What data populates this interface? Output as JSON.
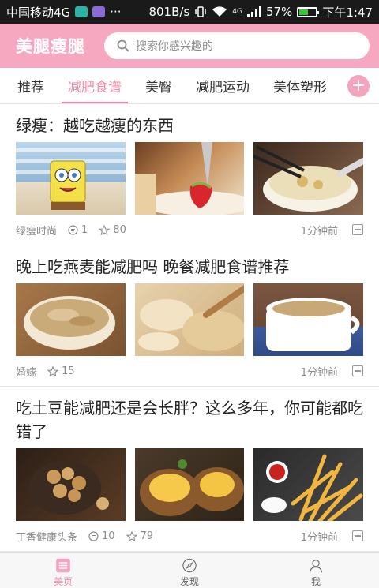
{
  "status_bar": {
    "carrier": "中国移动4G",
    "more": "···",
    "speed": "801B/s",
    "network": "4G",
    "battery": "57%",
    "battery_level": 0.57,
    "time": "下午1:47"
  },
  "header": {
    "title": "美腿瘦腿",
    "search_placeholder": "搜索你感兴趣的"
  },
  "tabs": [
    {
      "label": "推荐",
      "active": false
    },
    {
      "label": "减肥食谱",
      "active": true
    },
    {
      "label": "美臀",
      "active": false
    },
    {
      "label": "减肥运动",
      "active": false
    },
    {
      "label": "美体塑形",
      "active": false
    }
  ],
  "articles": [
    {
      "title": "绿瘦：越吃越瘦的东西",
      "source": "绿瘦时尚",
      "comments": "1",
      "stars": "80",
      "time": "1分钟前"
    },
    {
      "title": "晚上吃燕麦能减肥吗 晚餐减肥食谱推荐",
      "source": "婚嫁",
      "stars": "15",
      "time": "1分钟前"
    },
    {
      "title": "吃土豆能减肥还是会长胖？这么多年，你可能都吃错了",
      "source": "丁香健康头条",
      "comments": "10",
      "stars": "79",
      "time": "1分钟前"
    }
  ],
  "bottom_nav": [
    {
      "label": "美页",
      "icon": "list-icon",
      "active": true
    },
    {
      "label": "发现",
      "icon": "compass-icon",
      "active": false
    },
    {
      "label": "我",
      "icon": "user-icon",
      "active": false
    }
  ],
  "colors": {
    "brand_pink": "#f7a8c1",
    "accent_pink": "#f08ca8"
  }
}
